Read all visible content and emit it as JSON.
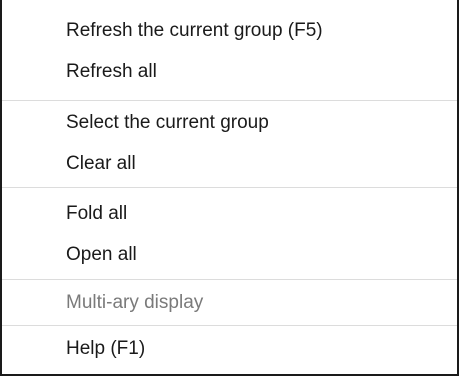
{
  "menu": {
    "items": [
      {
        "label": "Refresh the current group (F5)",
        "enabled": true
      },
      {
        "label": "Refresh all",
        "enabled": true
      },
      {
        "label": "Select the current group",
        "enabled": true
      },
      {
        "label": "Clear all",
        "enabled": true
      },
      {
        "label": "Fold all",
        "enabled": true
      },
      {
        "label": "Open all",
        "enabled": true
      },
      {
        "label": "Multi-ary display",
        "enabled": false
      },
      {
        "label": "Help (F1)",
        "enabled": true
      }
    ],
    "colors": {
      "text": "#1a1a1a",
      "disabled_text": "#7a7a7a",
      "separator": "#dcdcdc",
      "border": "#1a1a1a",
      "background": "#ffffff"
    }
  }
}
